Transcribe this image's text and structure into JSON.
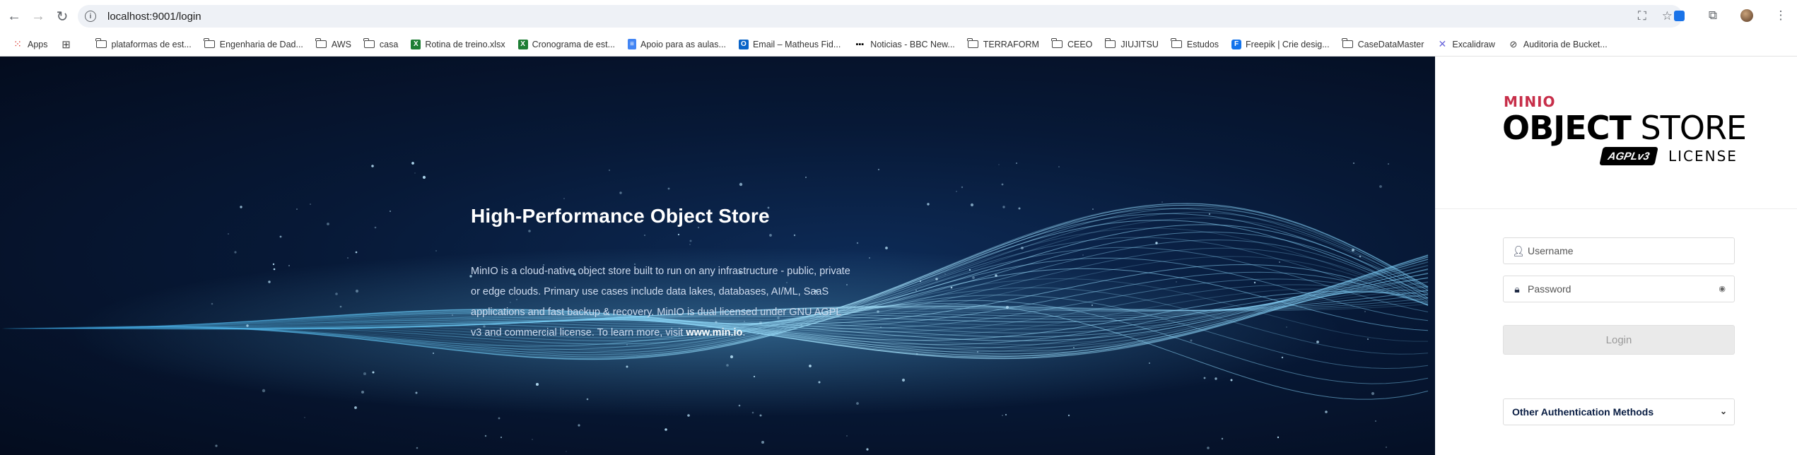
{
  "browser": {
    "url": "localhost:9001/login",
    "nav": {
      "back_icon": "←",
      "forward_icon": "→",
      "reload_icon": "↻"
    }
  },
  "bookmarks": {
    "items": [
      {
        "label": "Apps",
        "icon": "apps-grid-icon",
        "type": "apps"
      },
      {
        "label": "",
        "icon": "tab-groups-icon",
        "type": "grid"
      },
      {
        "label": "plataformas de est...",
        "icon": "folder-icon",
        "type": "folder"
      },
      {
        "label": "Engenharia de Dad...",
        "icon": "folder-icon",
        "type": "folder"
      },
      {
        "label": "AWS",
        "icon": "folder-icon",
        "type": "folder"
      },
      {
        "label": "casa",
        "icon": "folder-icon",
        "type": "folder"
      },
      {
        "label": "Rotina de treino.xlsx",
        "icon": "excel-icon",
        "type": "excel"
      },
      {
        "label": "Cronograma de est...",
        "icon": "excel-icon",
        "type": "excel"
      },
      {
        "label": "Apoio para as aulas...",
        "icon": "docs-icon",
        "type": "docs"
      },
      {
        "label": "Email – Matheus Fid...",
        "icon": "outlook-icon",
        "type": "outlook"
      },
      {
        "label": "Noticias - BBC New...",
        "icon": "bbc-icon",
        "type": "bbc"
      },
      {
        "label": "TERRAFORM",
        "icon": "folder-icon",
        "type": "folder"
      },
      {
        "label": "CEEO",
        "icon": "folder-icon",
        "type": "folder"
      },
      {
        "label": "JIUJITSU",
        "icon": "folder-icon",
        "type": "folder"
      },
      {
        "label": "Estudos",
        "icon": "folder-icon",
        "type": "folder"
      },
      {
        "label": "Freepik | Crie desig...",
        "icon": "freepik-icon",
        "type": "freepik"
      },
      {
        "label": "CaseDataMaster",
        "icon": "folder-icon",
        "type": "folder"
      },
      {
        "label": "Excalidraw",
        "icon": "excalidraw-icon",
        "type": "excalidraw"
      },
      {
        "label": "Auditoria de Bucket...",
        "icon": "audit-icon",
        "type": "audit"
      }
    ]
  },
  "hero": {
    "title": "High-Performance Object Store",
    "body": "MinIO is a cloud-native object store built to run on any infrastructure - public, private or edge clouds. Primary use cases include data lakes, databases, AI/ML, SaaS applications and fast backup & recovery. MinIO is dual licensed under GNU AGPL v3 and commercial license. To learn more, visit ",
    "link": "www.min.io",
    "end": "."
  },
  "login": {
    "brand_small": "MINIO",
    "brand_bold": "OBJECT",
    "brand_light": " STORE",
    "agpl_badge": "AGPLv3",
    "license": "LICENSE",
    "username_placeholder": "Username",
    "password_placeholder": "Password",
    "login_button": "Login",
    "other_auth": "Other Authentication Methods"
  },
  "colors": {
    "minio_red": "#c72e49",
    "navy": "#081c42",
    "hero_bg": "#071937"
  }
}
